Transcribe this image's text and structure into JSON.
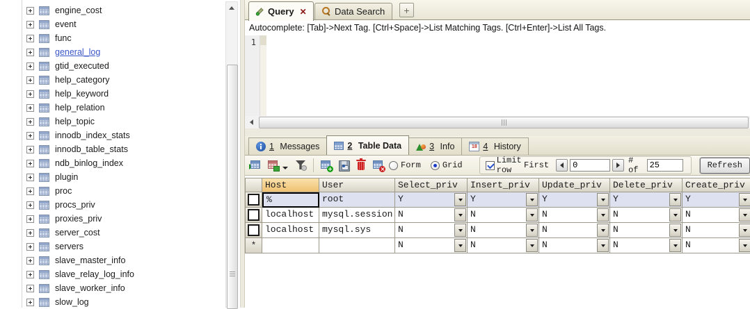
{
  "sidebar": {
    "selected_item": "general_log",
    "items": [
      "engine_cost",
      "event",
      "func",
      "general_log",
      "gtid_executed",
      "help_category",
      "help_keyword",
      "help_relation",
      "help_topic",
      "innodb_index_stats",
      "innodb_table_stats",
      "ndb_binlog_index",
      "plugin",
      "proc",
      "procs_priv",
      "proxies_priv",
      "server_cost",
      "servers",
      "slave_master_info",
      "slave_relay_log_info",
      "slave_worker_info",
      "slow_log"
    ]
  },
  "query_area": {
    "tabs": [
      {
        "label": "Query",
        "icon": "pencil-icon",
        "close_glyph": "✕",
        "active": true
      },
      {
        "label": "Data Search",
        "icon": "magnifier-icon",
        "active": false
      }
    ],
    "new_tab_glyph": "+",
    "autocomplete_hint": "Autocomplete: [Tab]->Next Tag. [Ctrl+Space]->List Matching Tags. [Ctrl+Enter]->List All Tags.",
    "line_number": "1"
  },
  "result_area": {
    "tabs": [
      {
        "num": "1",
        "label": "Messages",
        "icon": "info-icon",
        "active": false
      },
      {
        "num": "2",
        "label": "Table Data",
        "icon": "table-data-icon",
        "active": true
      },
      {
        "num": "3",
        "label": "Info",
        "icon": "chart-icon",
        "active": false
      },
      {
        "num": "4",
        "label": "History",
        "icon": "calendar-icon",
        "calendar_day": "18",
        "active": false
      }
    ],
    "toolbar": {
      "mode_options": [
        "Form",
        "Grid"
      ],
      "mode_selected": "Grid",
      "limit_checked": true,
      "limit_label": "Limit row",
      "first_label": "First",
      "row_start": "0",
      "of_label": "# of",
      "row_count": "25",
      "refresh_label": "Refresh"
    },
    "grid": {
      "columns": [
        "Host",
        "User",
        "Select_priv",
        "Insert_priv",
        "Update_priv",
        "Delete_priv",
        "Create_priv"
      ],
      "selected_column": "Host",
      "new_row_marker": "*",
      "rows": [
        {
          "cells": [
            "%",
            "root",
            "Y",
            "Y",
            "Y",
            "Y",
            "Y"
          ],
          "selected": true
        },
        {
          "cells": [
            "localhost",
            "mysql.session",
            "N",
            "N",
            "N",
            "N",
            "N"
          ],
          "selected": false
        },
        {
          "cells": [
            "localhost",
            "mysql.sys",
            "N",
            "N",
            "N",
            "N",
            "N"
          ],
          "selected": false
        },
        {
          "cells": [
            "",
            "",
            "N",
            "N",
            "N",
            "N",
            "N"
          ],
          "is_new_row": true
        }
      ]
    }
  },
  "icons": {
    "pencil-icon": "query pencil",
    "magnifier-icon": "search magnifier",
    "new-tab-plus-icon": "+",
    "info-icon": "blue i circle",
    "table-data-icon": "blue table grid",
    "chart-icon": "green triangle with red ball",
    "calendar-icon": "calendar page 18",
    "open-table-icon": "table with green arrow",
    "insert-table-dropdown-icon": "table with green square and caret",
    "filter-icon": "dark funnel",
    "add-row-icon": "table with green plus",
    "save-icon": "floppy disk",
    "delete-row-icon": "red trash can",
    "cancel-changes-icon": "table with red x",
    "expand-icon": "plus box",
    "scroll-arrows": "triangles"
  }
}
